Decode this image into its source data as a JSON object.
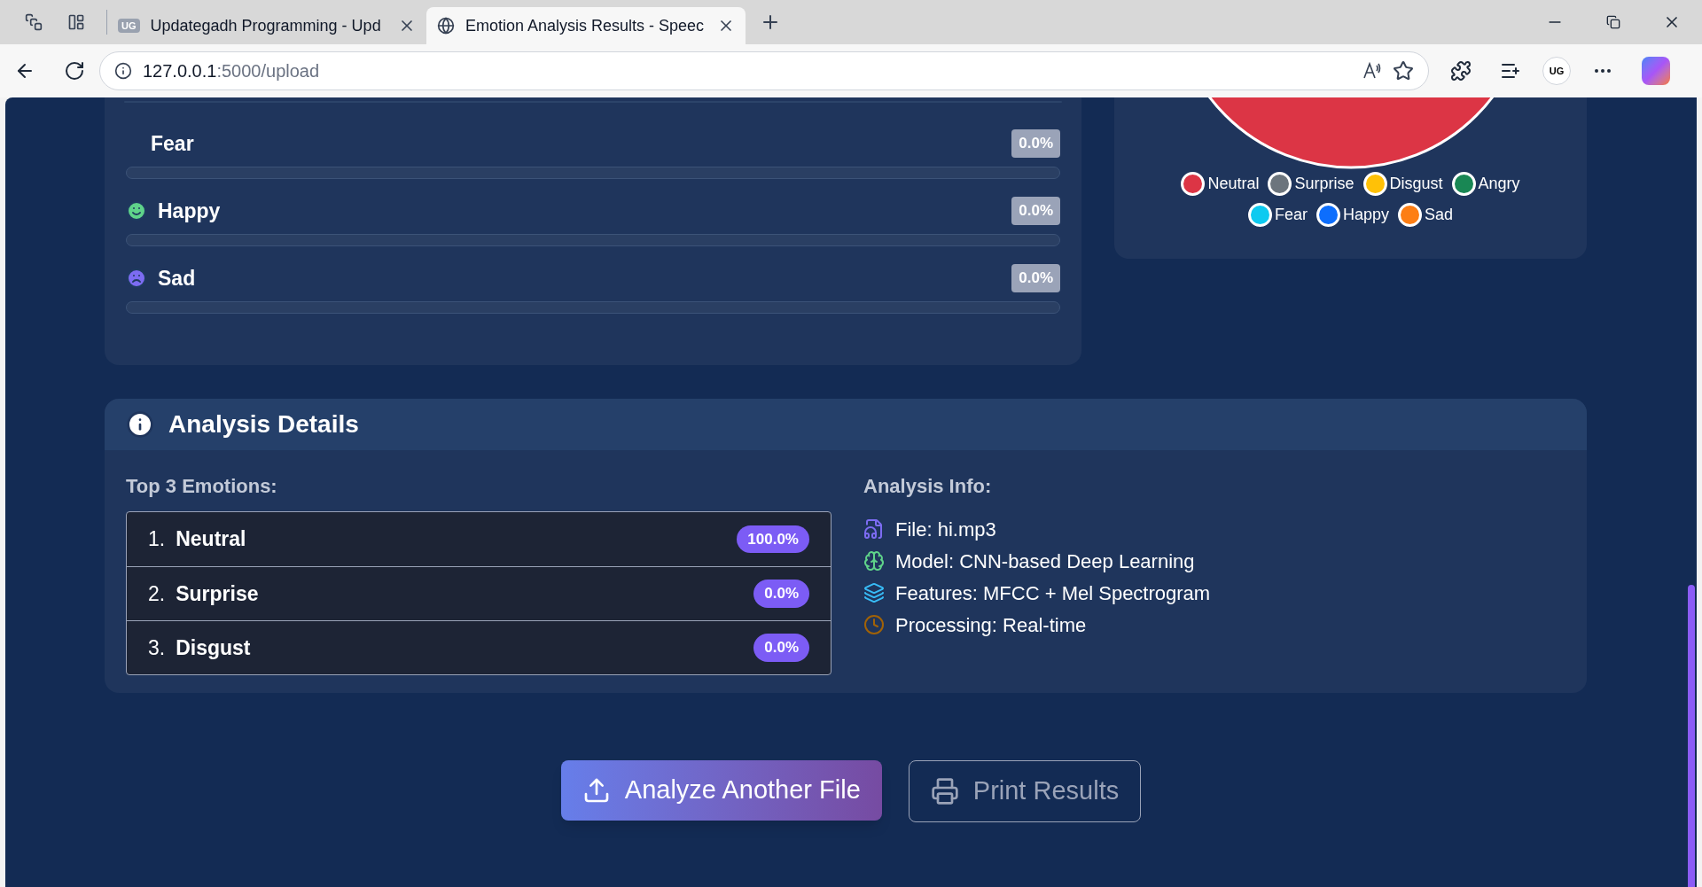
{
  "browser": {
    "tabs": [
      {
        "title": "Updategadh Programming - Upd",
        "favicon": "UG",
        "selected": false
      },
      {
        "title": "Emotion Analysis Results - Speec",
        "selected": true
      }
    ],
    "address": {
      "host": "127.0.0.1",
      "path": ":5000/upload"
    },
    "profile": "UG"
  },
  "emotion_bars": [
    {
      "name": "Fear",
      "kind": "plain",
      "value": "0.0%",
      "level": 0
    },
    {
      "name": "Happy",
      "kind": "smile",
      "value": "0.0%",
      "level": 0
    },
    {
      "name": "Sad",
      "kind": "sad",
      "value": "0.0%",
      "level": 0
    }
  ],
  "chart_legend": [
    {
      "label": "Neutral",
      "color": "#dc3545"
    },
    {
      "label": "Surprise",
      "color": "#6c757d"
    },
    {
      "label": "Disgust",
      "color": "#ffc107"
    },
    {
      "label": "Angry",
      "color": "#198754"
    },
    {
      "label": "Fear",
      "color": "#0dcaf0"
    },
    {
      "label": "Happy",
      "color": "#0d6efd"
    },
    {
      "label": "Sad",
      "color": "#fd7e14"
    }
  ],
  "analysis_details": {
    "title": "Analysis Details",
    "top_heading": "Top 3 Emotions:",
    "top_emotions": [
      {
        "rank": "1.",
        "name": "Neutral",
        "value": "100.0%"
      },
      {
        "rank": "2.",
        "name": "Surprise",
        "value": "0.0%"
      },
      {
        "rank": "3.",
        "name": "Disgust",
        "value": "0.0%"
      }
    ],
    "info_heading": "Analysis Info:",
    "info": [
      {
        "kind": "file",
        "text": "File: hi.mp3"
      },
      {
        "kind": "model",
        "text": "Model: CNN-based Deep Learning"
      },
      {
        "kind": "features",
        "text": "Features: MFCC + Mel Spectrogram"
      },
      {
        "kind": "processing",
        "text": "Processing: Real-time"
      }
    ]
  },
  "actions": [
    {
      "kind": "primary",
      "label": "Analyze Another File"
    },
    {
      "kind": "outline",
      "label": "Print Results"
    }
  ]
}
